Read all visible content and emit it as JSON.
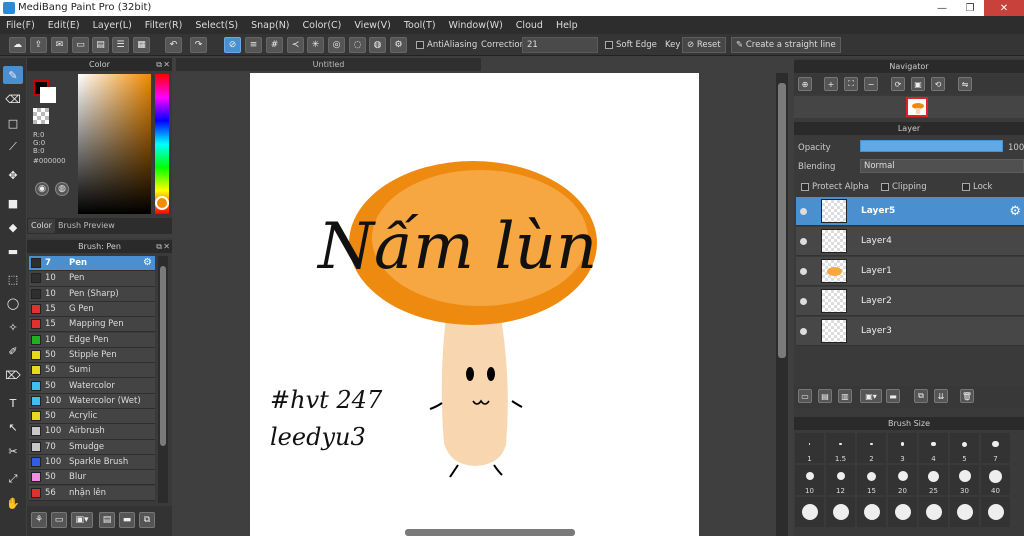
{
  "window": {
    "title": "MediBang Paint Pro (32bit)",
    "min": "—",
    "max": "❐",
    "close": "✕"
  },
  "menu": [
    "File(F)",
    "Edit(E)",
    "Layer(L)",
    "Filter(R)",
    "Select(S)",
    "Snap(N)",
    "Color(C)",
    "View(V)",
    "Tool(T)",
    "Window(W)",
    "Cloud",
    "Help"
  ],
  "toolbar": {
    "antialiasing": "AntiAliasing",
    "correction_label": "Correction",
    "correction_value": "21",
    "soft_edge": "Soft Edge",
    "key": "Key",
    "reset": "Reset",
    "straight_line": "Create a straight line"
  },
  "color_panel": {
    "title": "Color",
    "r": "R:0",
    "g": "G:0",
    "b": "B:0",
    "hex": "#000000",
    "tab_color": "Color",
    "tab_preview": "Brush Preview",
    "fg_color": "#000000",
    "bg_color": "#ffffff"
  },
  "brush_panel": {
    "title": "Brush: Pen",
    "items": [
      {
        "size": "7",
        "name": "Pen",
        "color": "#2f2f2f"
      },
      {
        "size": "10",
        "name": "Pen",
        "color": "#2f2f2f"
      },
      {
        "size": "10",
        "name": "Pen (Sharp)",
        "color": "#2f2f2f"
      },
      {
        "size": "15",
        "name": "G Pen",
        "color": "#e03030"
      },
      {
        "size": "15",
        "name": "Mapping Pen",
        "color": "#e03030"
      },
      {
        "size": "10",
        "name": "Edge Pen",
        "color": "#20b020"
      },
      {
        "size": "50",
        "name": "Stipple Pen",
        "color": "#e8d820"
      },
      {
        "size": "50",
        "name": "Sumi",
        "color": "#e8d820"
      },
      {
        "size": "50",
        "name": "Watercolor",
        "color": "#40c0f0"
      },
      {
        "size": "100",
        "name": "Watercolor (Wet)",
        "color": "#40c0f0"
      },
      {
        "size": "50",
        "name": "Acrylic",
        "color": "#e8d820"
      },
      {
        "size": "100",
        "name": "Airbrush",
        "color": "#c8c8c8"
      },
      {
        "size": "70",
        "name": "Smudge",
        "color": "#c8c8c8"
      },
      {
        "size": "100",
        "name": "Sparkle Brush",
        "color": "#3060e0"
      },
      {
        "size": "50",
        "name": "Blur",
        "color": "#f090e0"
      },
      {
        "size": "56",
        "name": "nhận lên",
        "color": "#e03030"
      }
    ]
  },
  "document": {
    "tab": "Untitled"
  },
  "drawing": {
    "main_text": "Nấm lùn",
    "tag_line1": "#hvt 247",
    "tag_line2": "leedyu3"
  },
  "navigator": {
    "title": "Navigator"
  },
  "layer_panel": {
    "title": "Layer",
    "opacity_label": "Opacity",
    "opacity_value": "100",
    "blending_label": "Blending",
    "blending_value": "Normal",
    "protect_alpha": "Protect Alpha",
    "clipping": "Clipping",
    "lock": "Lock",
    "layers": [
      "Layer5",
      "Layer4",
      "Layer1",
      "Layer2",
      "Layer3"
    ]
  },
  "brush_size": {
    "title": "Brush Size",
    "row1": [
      "1",
      "1.5",
      "2",
      "3",
      "4",
      "5",
      "7"
    ],
    "row2": [
      "10",
      "12",
      "15",
      "20",
      "25",
      "30",
      "40"
    ]
  }
}
